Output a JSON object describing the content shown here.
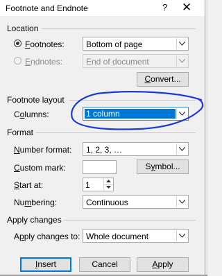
{
  "dialog": {
    "title": "Footnote and Endnote",
    "help_icon": "?",
    "close_icon": "✕"
  },
  "location": {
    "heading": "Location",
    "footnotes_label": "Footnotes:",
    "footnotes_value": "Bottom of page",
    "endnotes_label": "Endnotes:",
    "endnotes_value": "End of document",
    "convert_label": "Convert..."
  },
  "layout": {
    "heading": "Footnote layout",
    "columns_label": "Columns:",
    "columns_value": "1 column"
  },
  "format": {
    "heading": "Format",
    "number_format_label": "Number format:",
    "number_format_value": "1, 2, 3, …",
    "custom_mark_label": "Custom mark:",
    "custom_mark_value": "",
    "symbol_label": "Symbol...",
    "start_at_label": "Start at:",
    "start_at_value": "1",
    "numbering_label": "Numbering:",
    "numbering_value": "Continuous"
  },
  "apply": {
    "heading": "Apply changes",
    "apply_to_label": "Apply changes to:",
    "apply_to_value": "Whole document"
  },
  "buttons": {
    "insert": "Insert",
    "cancel": "Cancel",
    "apply": "Apply"
  },
  "colors": {
    "selection": "#0078d7",
    "annotation": "#1a3ad8"
  }
}
